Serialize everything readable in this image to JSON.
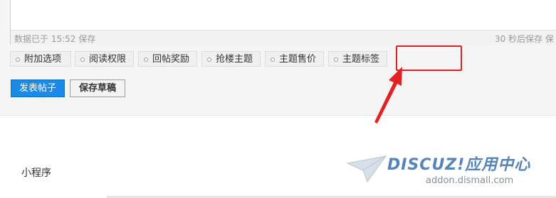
{
  "editor": {
    "autosave_status": "数据已于 15:52 保存",
    "autosave_countdown": "30 秒后保存 保"
  },
  "options": [
    {
      "label": "附加选项"
    },
    {
      "label": "阅读权限"
    },
    {
      "label": "回帖奖励"
    },
    {
      "label": "抢楼主题"
    },
    {
      "label": "主题售价"
    },
    {
      "label": "主题标签"
    }
  ],
  "actions": {
    "publish_label": "发表帖子",
    "save_draft_label": "保存草稿"
  },
  "section": {
    "title": "小程序"
  },
  "watermark": {
    "brand": "DISCUZ!应用中心",
    "site": "addon.dismall.com"
  },
  "colors": {
    "primary": "#1a8ae6",
    "annotation": "#e62020",
    "watermark": "#1f5aa8"
  },
  "icons": {
    "annotation_arrow": "red-arrow-icon",
    "option_bullet": "bullet-dot-icon",
    "watermark_logo": "paper-plane-icon"
  }
}
